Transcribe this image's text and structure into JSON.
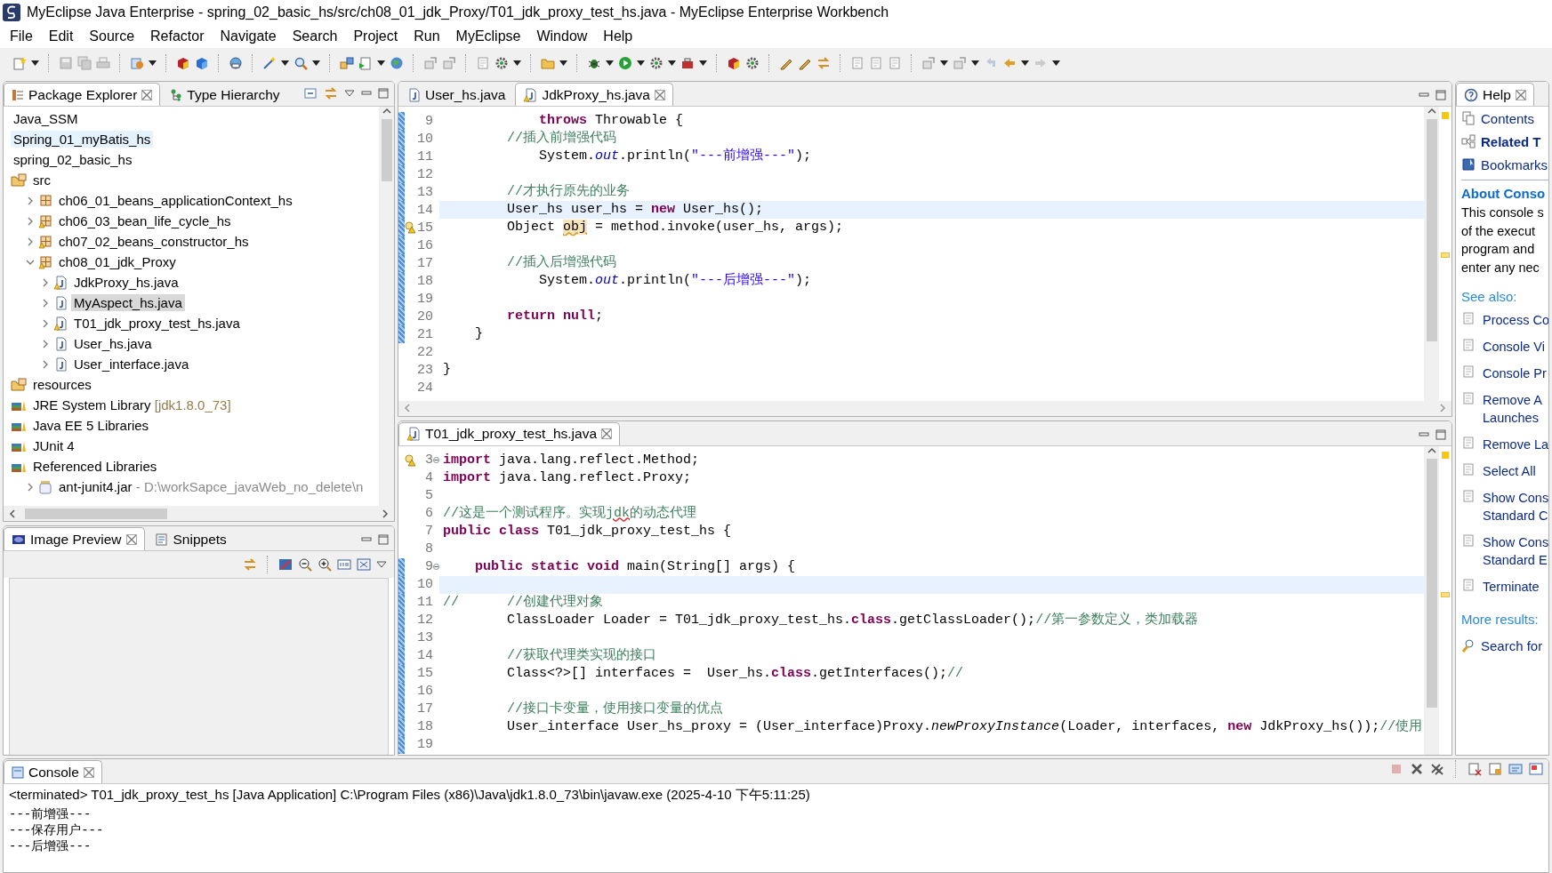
{
  "window": {
    "title": "MyEclipse Java Enterprise - spring_02_basic_hs/src/ch08_01_jdk_Proxy/T01_jdk_proxy_test_hs.java - MyEclipse Enterprise Workbench"
  },
  "menu": [
    "File",
    "Edit",
    "Source",
    "Refactor",
    "Navigate",
    "Search",
    "Project",
    "Run",
    "MyEclipse",
    "Window",
    "Help"
  ],
  "package_explorer": {
    "tabs": [
      {
        "label": "Package Explorer",
        "selected": true
      },
      {
        "label": "Type Hierarchy",
        "selected": false
      }
    ],
    "tree": [
      {
        "label": "Java_SSM",
        "kind": "project",
        "selected": false,
        "hover": false
      },
      {
        "label": "Spring_01_myBatis_hs",
        "kind": "project",
        "selected": false,
        "hover": true
      },
      {
        "label": "spring_02_basic_hs",
        "kind": "project",
        "selected": false,
        "hover": false
      },
      {
        "label": "src",
        "kind": "source",
        "selected": false,
        "hover": false,
        "children": [
          {
            "label": "ch06_01_beans_applicationContext_hs",
            "kind": "package",
            "selected": false,
            "hover": false,
            "warning": false,
            "expanded": false
          },
          {
            "label": "ch06_03_bean_life_cycle_hs",
            "kind": "package",
            "selected": false,
            "hover": false,
            "warning": true,
            "expanded": false
          },
          {
            "label": "ch07_02_beans_constructor_hs",
            "kind": "package",
            "selected": false,
            "hover": false,
            "warning": true,
            "expanded": false
          },
          {
            "label": "ch08_01_jdk_Proxy",
            "kind": "package",
            "selected": false,
            "hover": false,
            "warning": true,
            "expanded": true,
            "children": [
              {
                "label": "JdkProxy_hs.java",
                "kind": "java",
                "selected": false,
                "hover": false,
                "warning": true,
                "expanded": false
              },
              {
                "label": "MyAspect_hs.java",
                "kind": "java",
                "selected": true,
                "hover": false,
                "warning": false,
                "expanded": false
              },
              {
                "label": "T01_jdk_proxy_test_hs.java",
                "kind": "java",
                "selected": false,
                "hover": false,
                "warning": true,
                "expanded": false
              },
              {
                "label": "User_hs.java",
                "kind": "java",
                "selected": false,
                "hover": false,
                "warning": false,
                "expanded": false
              },
              {
                "label": "User_interface.java",
                "kind": "java",
                "selected": false,
                "hover": false,
                "warning": false,
                "expanded": false
              }
            ]
          }
        ]
      },
      {
        "label": "resources",
        "kind": "source",
        "selected": false,
        "hover": false
      },
      {
        "label": "JRE System Library",
        "decoration": " [jdk1.8.0_73]",
        "kind": "library",
        "selected": false,
        "hover": false
      },
      {
        "label": "Java EE 5 Libraries",
        "kind": "library",
        "selected": false,
        "hover": false
      },
      {
        "label": "JUnit 4",
        "kind": "library",
        "selected": false,
        "hover": false
      },
      {
        "label": "Referenced Libraries",
        "kind": "library",
        "selected": false,
        "hover": false,
        "children": [
          {
            "label": "ant-junit4.jar",
            "decoration": " - D:\\workSapce_javaWeb_no_delete\\n",
            "kind": "jar",
            "selected": false,
            "hover": false,
            "expanded": false
          }
        ]
      }
    ]
  },
  "image_preview": {
    "tabs": [
      {
        "label": "Image Preview",
        "selected": true
      },
      {
        "label": "Snippets",
        "selected": false
      }
    ]
  },
  "editor_top": {
    "tabs": [
      {
        "label": "User_hs.java",
        "selected": false,
        "warning": false
      },
      {
        "label": "JdkProxy_hs.java",
        "selected": true,
        "warning": true
      }
    ],
    "lines": [
      {
        "n": "9",
        "current": false,
        "diff": true,
        "t": [
          {
            "kind": "kw",
            "text": "            throws"
          },
          {
            "kind": "plain",
            "text": " Throwable {"
          }
        ]
      },
      {
        "n": "10",
        "current": false,
        "diff": true,
        "t": [
          {
            "kind": "comment",
            "text": "        //插入前增强代码"
          }
        ]
      },
      {
        "n": "11",
        "current": false,
        "diff": true,
        "t": [
          {
            "kind": "plain",
            "text": "            System."
          },
          {
            "kind": "field",
            "text": "out"
          },
          {
            "kind": "plain",
            "text": ".println("
          },
          {
            "kind": "string",
            "text": "\"---前增强---\""
          },
          {
            "kind": "plain",
            "text": ");"
          }
        ]
      },
      {
        "n": "12",
        "current": false,
        "diff": true
      },
      {
        "n": "13",
        "current": false,
        "diff": true,
        "t": [
          {
            "kind": "comment",
            "text": "        //才执行原先的业务"
          }
        ]
      },
      {
        "n": "14",
        "current": true,
        "diff": true,
        "t": [
          {
            "kind": "plain",
            "text": "        User_hs user_hs = "
          },
          {
            "kind": "kw",
            "text": "new"
          },
          {
            "kind": "plain",
            "text": " User_hs();"
          }
        ]
      },
      {
        "n": "15",
        "current": false,
        "diff": true,
        "warning": true,
        "t": [
          {
            "kind": "plain",
            "text": "        Object "
          },
          {
            "kind": "warn",
            "text": "obj"
          },
          {
            "kind": "plain",
            "text": " = method.invoke(user_hs, args);"
          }
        ]
      },
      {
        "n": "16",
        "current": false,
        "diff": true
      },
      {
        "n": "17",
        "current": false,
        "diff": true,
        "t": [
          {
            "kind": "comment",
            "text": "        //插入后增强代码"
          }
        ]
      },
      {
        "n": "18",
        "current": false,
        "diff": true,
        "t": [
          {
            "kind": "plain",
            "text": "            System."
          },
          {
            "kind": "field",
            "text": "out"
          },
          {
            "kind": "plain",
            "text": ".println("
          },
          {
            "kind": "string",
            "text": "\"---后增强---\""
          },
          {
            "kind": "plain",
            "text": ");"
          }
        ]
      },
      {
        "n": "19",
        "current": false,
        "diff": true
      },
      {
        "n": "20",
        "current": false,
        "diff": true,
        "t": [
          {
            "kind": "kw",
            "text": "        return"
          },
          {
            "kind": "kw",
            "text": " null"
          },
          {
            "kind": "plain",
            "text": ";"
          }
        ]
      },
      {
        "n": "21",
        "current": false,
        "diff": true,
        "t": [
          {
            "kind": "plain",
            "text": "    }"
          }
        ]
      },
      {
        "n": "22",
        "current": false,
        "diff": false
      },
      {
        "n": "23",
        "current": false,
        "diff": false,
        "t": [
          {
            "kind": "plain",
            "text": "}"
          }
        ]
      },
      {
        "n": "24",
        "current": false,
        "diff": false
      }
    ]
  },
  "editor_bottom": {
    "tabs": [
      {
        "label": "T01_jdk_proxy_test_hs.java",
        "selected": true,
        "warning": true
      }
    ],
    "lines": [
      {
        "n": "3",
        "current": false,
        "diff": false,
        "warning": true,
        "fold": true,
        "t": [
          {
            "kind": "kw",
            "text": "import"
          },
          {
            "kind": "plain",
            "text": " java.lang.reflect.Method;"
          }
        ]
      },
      {
        "n": "4",
        "current": false,
        "diff": false,
        "t": [
          {
            "kind": "kw",
            "text": "import"
          },
          {
            "kind": "plain",
            "text": " java.lang.reflect.Proxy;"
          }
        ]
      },
      {
        "n": "5",
        "current": false,
        "diff": false
      },
      {
        "n": "6",
        "current": false,
        "diff": false,
        "t": [
          {
            "kind": "comment",
            "text": "//这是一个测试程序。实现"
          },
          {
            "kind": "typo",
            "text": "jdk"
          },
          {
            "kind": "comment",
            "text": "的动态代理"
          }
        ]
      },
      {
        "n": "7",
        "current": false,
        "diff": false,
        "t": [
          {
            "kind": "kw",
            "text": "public"
          },
          {
            "kind": "kw",
            "text": " class"
          },
          {
            "kind": "plain",
            "text": " T01_jdk_proxy_test_hs {"
          }
        ]
      },
      {
        "n": "8",
        "current": false,
        "diff": false
      },
      {
        "n": "9",
        "current": false,
        "diff": true,
        "fold": true,
        "t": [
          {
            "kind": "kw",
            "text": "    public"
          },
          {
            "kind": "kw",
            "text": " static"
          },
          {
            "kind": "kw",
            "text": " void"
          },
          {
            "kind": "plain",
            "text": " main(String[] args) {"
          }
        ]
      },
      {
        "n": "10",
        "current": true,
        "diff": true
      },
      {
        "n": "11",
        "current": false,
        "diff": true,
        "t": [
          {
            "kind": "comment",
            "text": "//      //创建代理对象"
          }
        ]
      },
      {
        "n": "12",
        "current": false,
        "diff": true,
        "t": [
          {
            "kind": "plain",
            "text": "        ClassLoader Loader = T01_jdk_proxy_test_hs."
          },
          {
            "kind": "kw",
            "text": "class"
          },
          {
            "kind": "plain",
            "text": ".getClassLoader();"
          },
          {
            "kind": "comment",
            "text": "//第一参数定义，类加载器"
          }
        ]
      },
      {
        "n": "13",
        "current": false,
        "diff": true
      },
      {
        "n": "14",
        "current": false,
        "diff": true,
        "t": [
          {
            "kind": "comment",
            "text": "        //获取代理类实现的接口"
          }
        ]
      },
      {
        "n": "15",
        "current": false,
        "diff": true,
        "t": [
          {
            "kind": "plain",
            "text": "        Class<?>[] interfaces =  User_hs."
          },
          {
            "kind": "kw",
            "text": "class"
          },
          {
            "kind": "plain",
            "text": ".getInterfaces();"
          },
          {
            "kind": "comment",
            "text": "//"
          }
        ]
      },
      {
        "n": "16",
        "current": false,
        "diff": true
      },
      {
        "n": "17",
        "current": false,
        "diff": true,
        "t": [
          {
            "kind": "comment",
            "text": "        //接口卡变量，使用接口变量的优点"
          }
        ]
      },
      {
        "n": "18",
        "current": false,
        "diff": true,
        "t": [
          {
            "kind": "plain",
            "text": "        User_interface User_hs_proxy = (User_interface)Proxy."
          },
          {
            "kind": "static",
            "text": "newProxyInstance"
          },
          {
            "kind": "plain",
            "text": "(Loader, interfaces, "
          },
          {
            "kind": "kw",
            "text": "new"
          },
          {
            "kind": "plain",
            "text": " JdkProxy_hs());"
          },
          {
            "kind": "comment",
            "text": "//使用"
          }
        ]
      },
      {
        "n": "19",
        "current": false,
        "diff": true
      }
    ]
  },
  "help": {
    "tab": "Help",
    "links": [
      {
        "label": "Contents",
        "kind": "contents"
      },
      {
        "label": "Related T",
        "kind": "related"
      },
      {
        "label": "Bookmarks",
        "kind": "bookmarks"
      }
    ],
    "heading": "About Conso",
    "body": [
      "This console s",
      "of the execut",
      "program and",
      "enter any nec"
    ],
    "see_also": "See also:",
    "topics": [
      {
        "lines": [
          "Process Co"
        ]
      },
      {
        "lines": [
          "Console Vi"
        ]
      },
      {
        "lines": [
          "Console Pr"
        ]
      },
      {
        "lines": [
          "Remove A",
          "Launches"
        ]
      },
      {
        "lines": [
          "Remove La"
        ]
      },
      {
        "lines": [
          "Select All"
        ]
      },
      {
        "lines": [
          "Show Cons",
          "Standard C"
        ]
      },
      {
        "lines": [
          "Show Cons",
          "Standard E"
        ]
      },
      {
        "lines": [
          "Terminate"
        ]
      }
    ],
    "more": "More results:",
    "search": "Search for"
  },
  "console": {
    "tab": "Console",
    "header": "<terminated> T01_jdk_proxy_test_hs [Java Application] C:\\Program Files (x86)\\Java\\jdk1.8.0_73\\bin\\javaw.exe (2025-4-10 下午5:11:25)",
    "output": [
      "---前增强---",
      "---保存用户---",
      "---后增强---"
    ]
  }
}
